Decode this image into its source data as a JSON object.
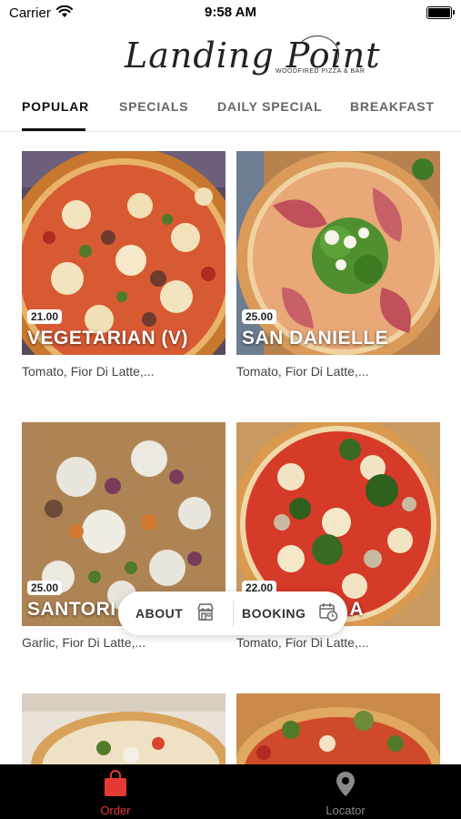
{
  "status_bar": {
    "carrier": "Carrier",
    "time": "9:58 AM"
  },
  "brand": {
    "logo_script": "Landing Point",
    "logo_tagline": "WOODFIRED PIZZA & BAR"
  },
  "tabs": [
    {
      "label": "POPULAR",
      "active": true
    },
    {
      "label": "SPECIALS",
      "active": false
    },
    {
      "label": "DAILY SPECIAL",
      "active": false
    },
    {
      "label": "BREAKFAST",
      "active": false
    }
  ],
  "menu_items": [
    {
      "name": "VEGETARIAN (V)",
      "price": "21.00",
      "description": "Tomato, Fior Di Latte,..."
    },
    {
      "name": "SAN DANIELLE",
      "price": "25.00",
      "description": "Tomato, Fior Di Latte,..."
    },
    {
      "name": "SANTORI",
      "price": "25.00",
      "description": "Garlic, Fior Di Latte,..."
    },
    {
      "name": "A",
      "price": "22.00",
      "description": "Tomato, Fior Di Latte,..."
    }
  ],
  "floating_actions": {
    "about_label": "ABOUT",
    "booking_label": "BOOKING"
  },
  "bottom_nav": [
    {
      "label": "Order",
      "icon": "shopping-bag-icon",
      "active": true
    },
    {
      "label": "Locator",
      "icon": "location-pin-icon",
      "active": false
    }
  ],
  "colors": {
    "accent": "#e53935",
    "nav_bg": "#000000",
    "nav_inactive": "#8a8a8a"
  }
}
